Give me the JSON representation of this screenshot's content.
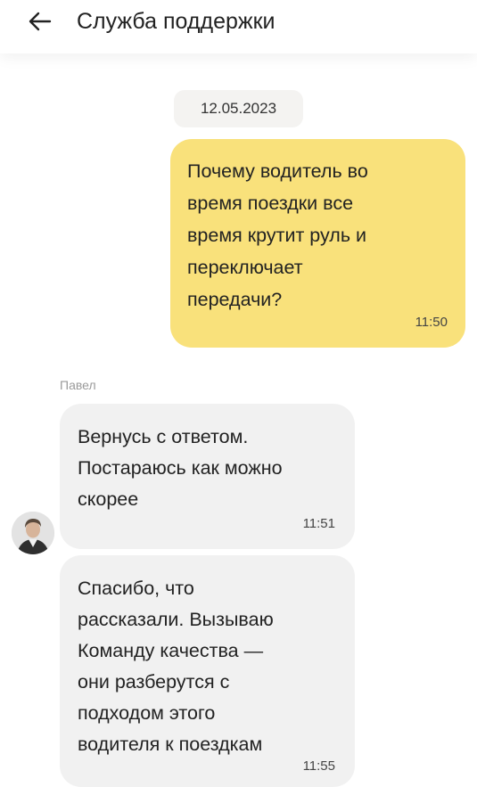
{
  "header": {
    "title": "Служба поддержки",
    "back_icon": "arrow-left-icon"
  },
  "chat": {
    "date": "12.05.2023",
    "messages": [
      {
        "direction": "outgoing",
        "text": "Почему водитель во\nвремя поездки все\nвремя крутит руль и\nпереключает\nпередачи?",
        "time": "11:50",
        "bubble_color": "#f9e17b"
      },
      {
        "direction": "incoming",
        "sender": "Павел",
        "text": "Вернусь с ответом.\nПостараюсь как можно\nскорее",
        "time": "11:51",
        "bubble_color": "#f1f1f1"
      },
      {
        "direction": "incoming",
        "text": "Спасибо, что\nрассказали. Вызываю\nКоманду качества —\nони разберутся с\nподходом этого\nводителя к поездкам",
        "time": "11:55",
        "bubble_color": "#f1f1f1"
      }
    ]
  }
}
